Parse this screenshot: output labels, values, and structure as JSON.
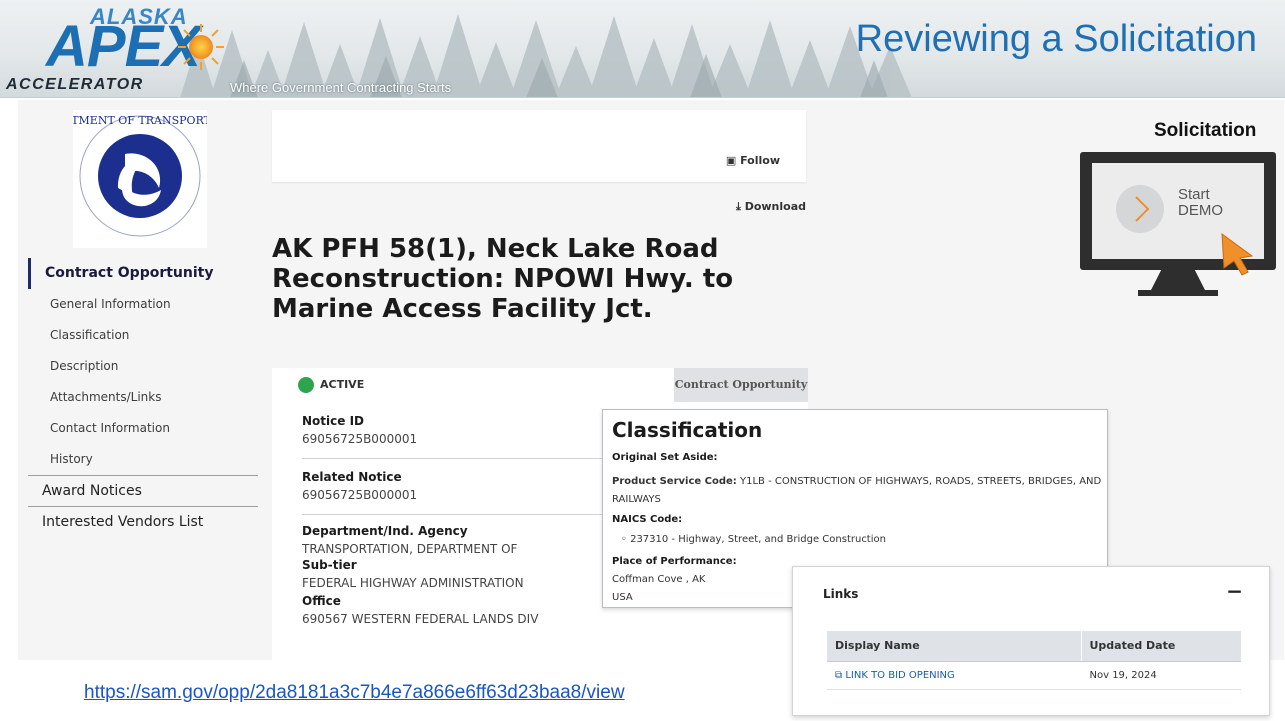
{
  "header": {
    "logo_alaska": "ALASKA",
    "logo_apex": "APEX",
    "logo_accelerator": "ACCELERATOR",
    "tagline": "Where Government Contracting Starts",
    "slide_title": "Reviewing a Solicitation"
  },
  "nav": {
    "items": [
      {
        "label": "Contract Opportunity"
      },
      {
        "label": "General Information"
      },
      {
        "label": "Classification"
      },
      {
        "label": "Description"
      },
      {
        "label": "Attachments/Links"
      },
      {
        "label": "Contact Information"
      },
      {
        "label": "History"
      },
      {
        "label": "Award Notices"
      },
      {
        "label": "Interested Vendors List"
      }
    ]
  },
  "actions": {
    "follow": "Follow",
    "download": "Download"
  },
  "opportunity": {
    "title": "AK PFH 58(1), Neck Lake Road Reconstruction: NPOWI Hwy. to Marine Access Facility Jct.",
    "status": "ACTIVE",
    "type_tab": "Contract Opportunity",
    "notice_id_label": "Notice ID",
    "notice_id": "69056725B000001",
    "related_notice_label": "Related Notice",
    "related_notice": "69056725B000001",
    "department_label": "Department/Ind. Agency",
    "department": "TRANSPORTATION, DEPARTMENT OF",
    "subtier_label": "Sub-tier",
    "subtier": "FEDERAL HIGHWAY ADMINISTRATION",
    "office_label": "Office",
    "office": "690567 WESTERN FEDERAL LANDS DIV"
  },
  "classification": {
    "title": "Classification",
    "set_aside_label": "Original Set Aside:",
    "psc_label": "Product Service Code:",
    "psc_value_line1": " Y1LB - CONSTRUCTION OF HIGHWAYS, ROADS, STREETS, BRIDGES, AND",
    "psc_value_line2": "RAILWAYS",
    "naics_label": "NAICS Code:",
    "naics_value": "◦  237310 - Highway, Street, and Bridge Construction",
    "pop_label": "Place of Performance:",
    "pop_line1": "Coffman Cove , AK",
    "pop_line2": "USA"
  },
  "links": {
    "title": "Links",
    "collapse_symbol": "−",
    "headers": [
      "Display Name",
      "Updated Date"
    ],
    "rows": [
      {
        "name": "LINK TO BID OPENING",
        "date": "Nov 19, 2024"
      }
    ]
  },
  "demo": {
    "label": "Solicitation",
    "start_line1": "Start",
    "start_line2": "DEMO"
  },
  "url": "https://sam.gov/opp/2da8181a3c7b4e7a866e6ff63d23baa8/view",
  "colors": {
    "brand_blue": "#1f6fb3",
    "active_green": "#2ea44f",
    "cursor_orange": "#f0902a"
  }
}
